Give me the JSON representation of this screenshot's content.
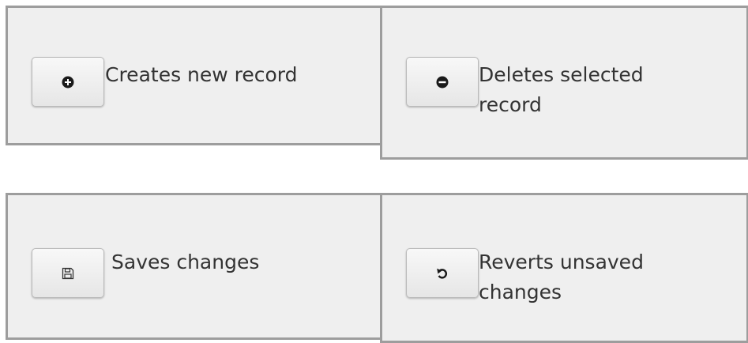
{
  "toolbar_help": [
    {
      "icon": "plus-circle-icon",
      "description": "Creates new record"
    },
    {
      "icon": "minus-circle-icon",
      "description": " Deletes selected record"
    },
    {
      "icon": "save-icon",
      "description": "Saves changes"
    },
    {
      "icon": "undo-icon",
      "description": " Reverts unsaved changes"
    }
  ]
}
